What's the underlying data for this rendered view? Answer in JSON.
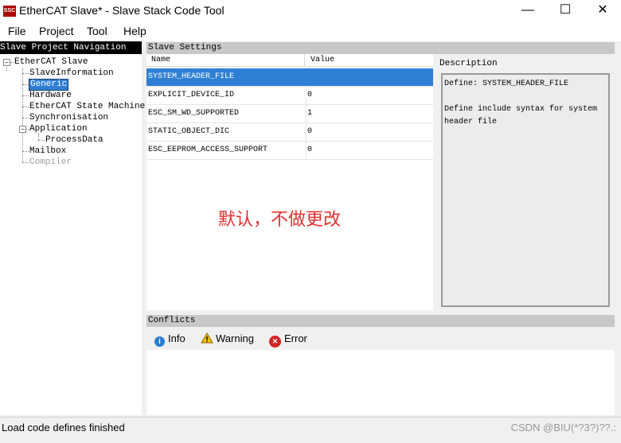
{
  "window": {
    "icon_text": "SSC",
    "title": "EtherCAT Slave* - Slave Stack Code Tool",
    "minimize_glyph": "—",
    "maximize_glyph": "☐",
    "close_glyph": "✕"
  },
  "menu": [
    "File",
    "Project",
    "Tool",
    "Help"
  ],
  "nav": {
    "header": "Slave Project Navigation",
    "expander_glyph": "−",
    "items": [
      {
        "label": "EtherCAT Slave",
        "level": 0,
        "selected": false,
        "disabled": false
      },
      {
        "label": "SlaveInformation",
        "level": 1,
        "selected": false,
        "disabled": false
      },
      {
        "label": "Generic",
        "level": 1,
        "selected": true,
        "disabled": false
      },
      {
        "label": "Hardware",
        "level": 1,
        "selected": false,
        "disabled": false
      },
      {
        "label": "EtherCAT State Machine",
        "level": 1,
        "selected": false,
        "disabled": false
      },
      {
        "label": "Synchronisation",
        "level": 1,
        "selected": false,
        "disabled": false
      },
      {
        "label": "Application",
        "level": 1,
        "selected": false,
        "disabled": false
      },
      {
        "label": "ProcessData",
        "level": 2,
        "selected": false,
        "disabled": false
      },
      {
        "label": "Mailbox",
        "level": 1,
        "selected": false,
        "disabled": false
      },
      {
        "label": "Compiler",
        "level": 1,
        "selected": false,
        "disabled": true
      }
    ]
  },
  "settings": {
    "header": "Slave Settings",
    "col_name": "Name",
    "col_value": "Value",
    "rows": [
      {
        "name": "SYSTEM_HEADER_FILE",
        "value": ""
      },
      {
        "name": "EXPLICIT_DEVICE_ID",
        "value": "0"
      },
      {
        "name": "ESC_SM_WD_SUPPORTED",
        "value": "1"
      },
      {
        "name": "STATIC_OBJECT_DIC",
        "value": "0"
      },
      {
        "name": "ESC_EEPROM_ACCESS_SUPPORT",
        "value": "0"
      }
    ],
    "selected_row": 0
  },
  "annotation": "默认，不做更改",
  "description": {
    "label": "Description",
    "line1": "Define: SYSTEM_HEADER_FILE",
    "line2": "Define include syntax for system header file"
  },
  "conflicts": {
    "header": "Conflicts",
    "info_label": "Info",
    "warning_label": "Warning",
    "error_label": "Error"
  },
  "status": {
    "text": "Load code defines finished",
    "watermark": "CSDN @BIU(*?3?)??.:"
  },
  "colors": {
    "selection": "#2f80d4",
    "annotation": "#e03030",
    "header_bg": "#c8c8c8"
  }
}
